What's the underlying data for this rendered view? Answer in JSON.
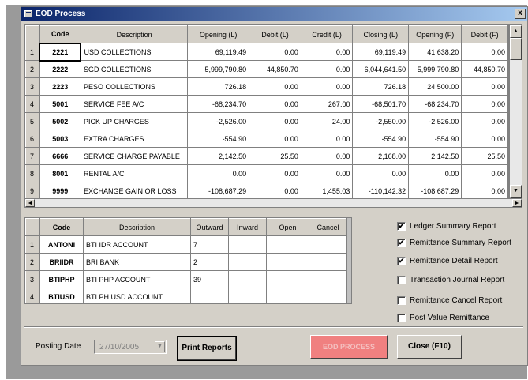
{
  "window": {
    "title": "EOD Process",
    "close_glyph": "x"
  },
  "ledger_grid": {
    "headers": [
      "Code",
      "Description",
      "Opening (L)",
      "Debit (L)",
      "Credit (L)",
      "Closing (L)",
      "Opening (F)",
      "Debit (F)"
    ],
    "rows": [
      {
        "n": "1",
        "code": "2221",
        "desc": "USD COLLECTIONS",
        "open_l": "69,119.49",
        "debit_l": "0.00",
        "credit_l": "0.00",
        "close_l": "69,119.49",
        "open_f": "41,638.20",
        "debit_f": "0.00"
      },
      {
        "n": "2",
        "code": "2222",
        "desc": "SGD COLLECTIONS",
        "open_l": "5,999,790.80",
        "debit_l": "44,850.70",
        "credit_l": "0.00",
        "close_l": "6,044,641.50",
        "open_f": "5,999,790.80",
        "debit_f": "44,850.70"
      },
      {
        "n": "3",
        "code": "2223",
        "desc": "PESO COLLECTIONS",
        "open_l": "726.18",
        "debit_l": "0.00",
        "credit_l": "0.00",
        "close_l": "726.18",
        "open_f": "24,500.00",
        "debit_f": "0.00"
      },
      {
        "n": "4",
        "code": "5001",
        "desc": "SERVICE FEE A/C",
        "open_l": "-68,234.70",
        "debit_l": "0.00",
        "credit_l": "267.00",
        "close_l": "-68,501.70",
        "open_f": "-68,234.70",
        "debit_f": "0.00"
      },
      {
        "n": "5",
        "code": "5002",
        "desc": "PICK UP CHARGES",
        "open_l": "-2,526.00",
        "debit_l": "0.00",
        "credit_l": "24.00",
        "close_l": "-2,550.00",
        "open_f": "-2,526.00",
        "debit_f": "0.00"
      },
      {
        "n": "6",
        "code": "5003",
        "desc": "EXTRA  CHARGES",
        "open_l": "-554.90",
        "debit_l": "0.00",
        "credit_l": "0.00",
        "close_l": "-554.90",
        "open_f": "-554.90",
        "debit_f": "0.00"
      },
      {
        "n": "7",
        "code": "6666",
        "desc": "SERVICE CHARGE PAYABLE",
        "open_l": "2,142.50",
        "debit_l": "25.50",
        "credit_l": "0.00",
        "close_l": "2,168.00",
        "open_f": "2,142.50",
        "debit_f": "25.50"
      },
      {
        "n": "8",
        "code": "8001",
        "desc": "RENTAL A/C",
        "open_l": "0.00",
        "debit_l": "0.00",
        "credit_l": "0.00",
        "close_l": "0.00",
        "open_f": "0.00",
        "debit_f": "0.00"
      },
      {
        "n": "9",
        "code": "9999",
        "desc": "EXCHANGE GAIN OR LOSS",
        "open_l": "-108,687.29",
        "debit_l": "0.00",
        "credit_l": "1,455.03",
        "close_l": "-110,142.32",
        "open_f": "-108,687.29",
        "debit_f": "0.00"
      }
    ]
  },
  "scroll": {
    "up": "▲",
    "down": "▼",
    "left": "◄",
    "right": "►"
  },
  "account_grid": {
    "headers": [
      "Code",
      "Description",
      "Outward",
      "Inward",
      "Open",
      "Cancel"
    ],
    "rows": [
      {
        "n": "1",
        "code": "ANTONI",
        "desc": "BTI IDR ACCOUNT",
        "outward": "7",
        "inward": "",
        "open": "",
        "cancel": ""
      },
      {
        "n": "2",
        "code": "BRIIDR",
        "desc": "BRI BANK",
        "outward": "2",
        "inward": "",
        "open": "",
        "cancel": ""
      },
      {
        "n": "3",
        "code": "BTIPHP",
        "desc": "BTI PHP ACCOUNT",
        "outward": "39",
        "inward": "",
        "open": "",
        "cancel": ""
      },
      {
        "n": "4",
        "code": "BTIUSD",
        "desc": "BTI PH USD ACCOUNT",
        "outward": "",
        "inward": "",
        "open": "",
        "cancel": ""
      }
    ]
  },
  "reports": [
    {
      "label": "Ledger Summary Report",
      "checked": true
    },
    {
      "label": "Remittance Summary Report",
      "checked": true
    },
    {
      "label": "Remittance Detail Report",
      "checked": true
    },
    {
      "label": "Transaction Journal Report",
      "checked": false
    },
    {
      "label": "Remittance Cancel Report",
      "checked": false
    },
    {
      "label": "Post Value Remittance",
      "checked": false
    }
  ],
  "check_mark": "✔",
  "footer": {
    "posting_label": "Posting Date",
    "posting_date": "27/10/2005",
    "dropdown_glyph": "▼",
    "print_label": "Print Reports",
    "eod_label": "EOD PROCESS",
    "close_label": "Close (F10)"
  }
}
